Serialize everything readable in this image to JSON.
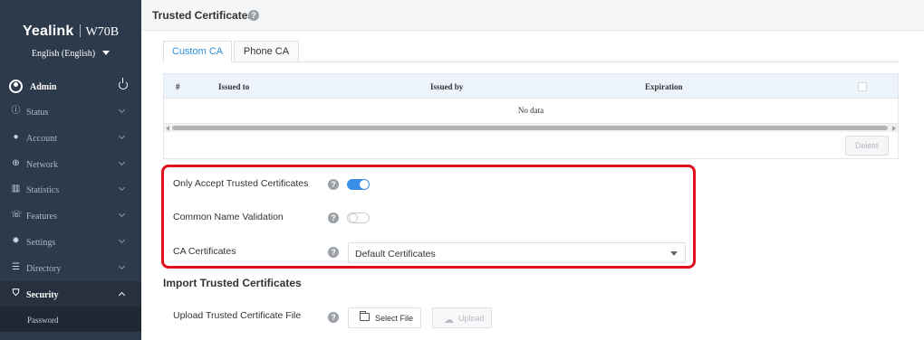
{
  "sidebar": {
    "brand": "Yealink",
    "model": "W70B",
    "language": "English (English)",
    "user": "Admin",
    "items": [
      {
        "label": "Status",
        "icon": "info-icon"
      },
      {
        "label": "Account",
        "icon": "user-icon"
      },
      {
        "label": "Network",
        "icon": "globe-icon"
      },
      {
        "label": "Statistics",
        "icon": "bar-chart-icon"
      },
      {
        "label": "Features",
        "icon": "phone-icon"
      },
      {
        "label": "Settings",
        "icon": "gear-icon"
      },
      {
        "label": "Directory",
        "icon": "contacts-icon"
      },
      {
        "label": "Security",
        "icon": "shield-icon"
      }
    ],
    "subitems": [
      "Password"
    ]
  },
  "header": {
    "title": "Trusted Certificates"
  },
  "tabs": [
    "Custom CA",
    "Phone CA"
  ],
  "table": {
    "columns": [
      "#",
      "Issued to",
      "Issued by",
      "Expiration"
    ],
    "empty_text": "No data",
    "delete_label": "Delete"
  },
  "settings": {
    "only_accept_label": "Only Accept Trusted Certificates",
    "only_accept_enabled": true,
    "common_name_label": "Common Name Validation",
    "common_name_enabled": false,
    "ca_label": "CA Certificates",
    "ca_value": "Default Certificates"
  },
  "import": {
    "title": "Import Trusted Certificates",
    "upload_label": "Upload Trusted Certificate File",
    "select_file": "Select File",
    "upload": "Upload"
  },
  "colors": {
    "accent": "#3a8ee6",
    "highlight": "#e0101c",
    "sidebar": "#2d3a4b"
  }
}
